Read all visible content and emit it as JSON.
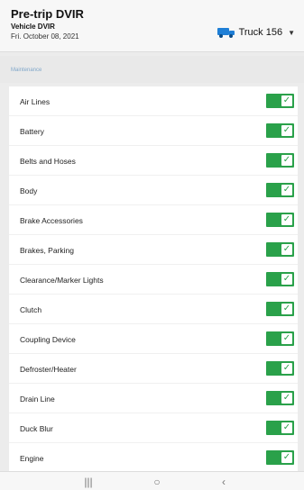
{
  "header": {
    "title": "Pre-trip DVIR",
    "subtitle": "Vehicle DVIR",
    "date": "Fri. October 08, 2021",
    "vehicle_selector": {
      "label": "Truck 156",
      "icon": "truck-icon",
      "dropdown_icon": "chevron-down-icon"
    }
  },
  "section": {
    "label": "Maintenance"
  },
  "items": [
    {
      "label": "Air Lines",
      "checked": true
    },
    {
      "label": "Battery",
      "checked": true
    },
    {
      "label": "Belts and Hoses",
      "checked": true
    },
    {
      "label": "Body",
      "checked": true
    },
    {
      "label": "Brake Accessories",
      "checked": true
    },
    {
      "label": "Brakes, Parking",
      "checked": true
    },
    {
      "label": "Clearance/Marker Lights",
      "checked": true
    },
    {
      "label": "Clutch",
      "checked": true
    },
    {
      "label": "Coupling Device",
      "checked": true
    },
    {
      "label": "Defroster/Heater",
      "checked": true
    },
    {
      "label": "Drain Line",
      "checked": true
    },
    {
      "label": "Duck Blur",
      "checked": true
    },
    {
      "label": "Engine",
      "checked": true
    }
  ],
  "navbar": {
    "recent_icon": "recent-apps-icon",
    "home_icon": "home-icon",
    "back_icon": "back-icon"
  },
  "colors": {
    "toggle_on": "#2aa14a",
    "section_label": "#7fa6c9"
  }
}
